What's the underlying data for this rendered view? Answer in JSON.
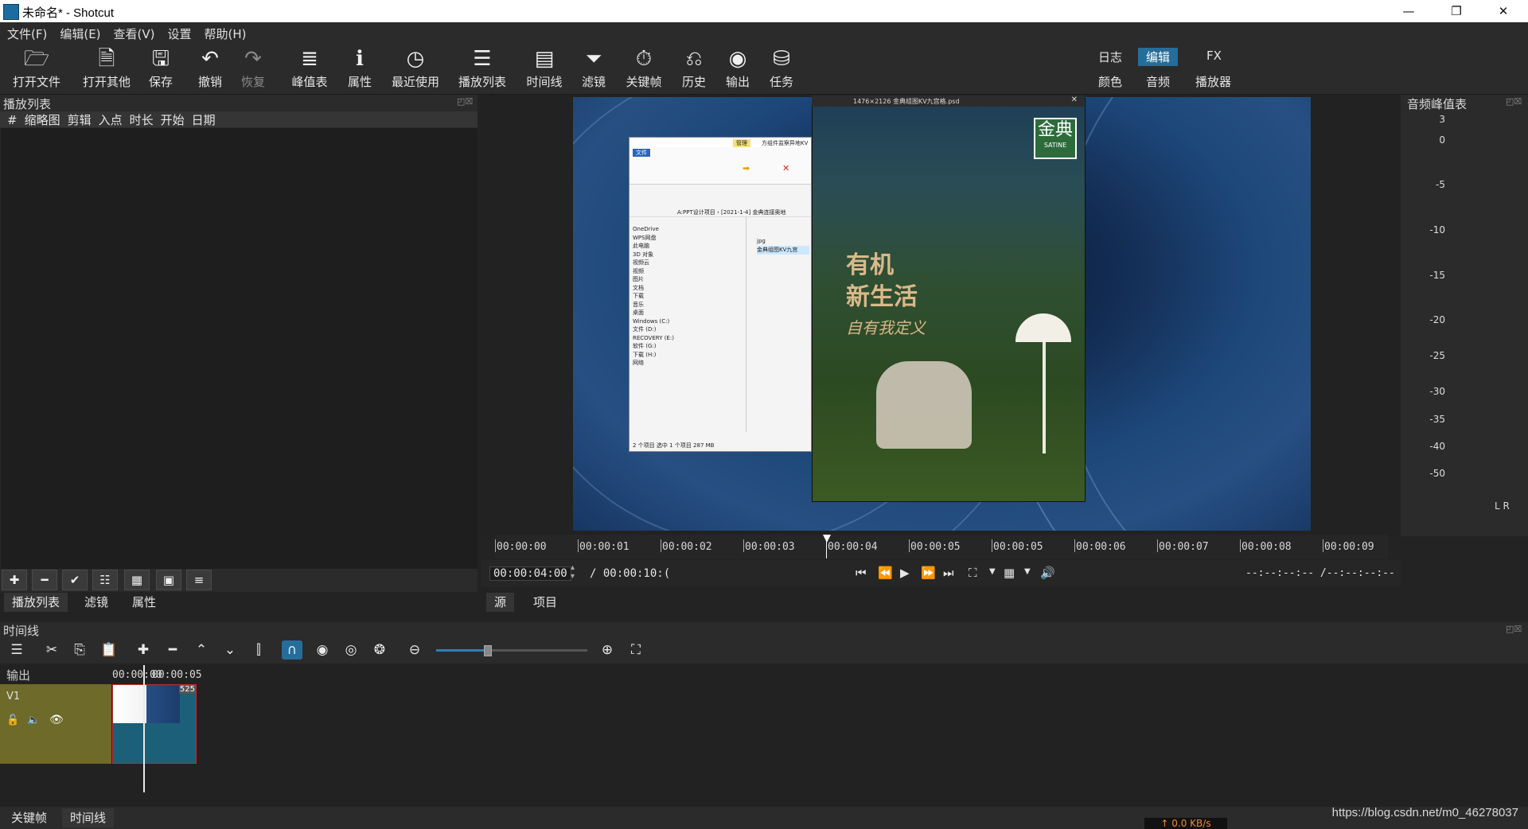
{
  "window": {
    "title": "未命名* - Shotcut",
    "minimize": "—",
    "restore": "❐",
    "close": "✕"
  },
  "menu": [
    "文件(F)",
    "编辑(E)",
    "查看(V)",
    "设置",
    "帮助(H)"
  ],
  "toolbar": {
    "buttons": [
      {
        "label": "打开文件",
        "icon": "folder-open-icon",
        "glyph": "🗁"
      },
      {
        "label": "打开其他",
        "icon": "file-add-icon",
        "glyph": "🗎"
      },
      {
        "label": "保存",
        "icon": "save-icon",
        "glyph": "🖫"
      },
      {
        "label": "撤销",
        "icon": "undo-icon",
        "glyph": "↶"
      },
      {
        "label": "恢复",
        "icon": "redo-icon",
        "glyph": "↷"
      },
      {
        "label": "峰值表",
        "icon": "meter-icon",
        "glyph": "≣"
      },
      {
        "label": "属性",
        "icon": "info-icon",
        "glyph": "ℹ"
      },
      {
        "label": "最近使用",
        "icon": "clock-icon",
        "glyph": "◷"
      },
      {
        "label": "播放列表",
        "icon": "list-icon",
        "glyph": "☰"
      },
      {
        "label": "时间线",
        "icon": "timeline-icon",
        "glyph": "▤"
      },
      {
        "label": "滤镜",
        "icon": "filter-icon",
        "glyph": "⏷"
      },
      {
        "label": "关键帧",
        "icon": "stopwatch-icon",
        "glyph": "⏱"
      },
      {
        "label": "历史",
        "icon": "history-icon",
        "glyph": "⎌"
      },
      {
        "label": "输出",
        "icon": "export-icon",
        "glyph": "◉"
      },
      {
        "label": "任务",
        "icon": "jobs-icon",
        "glyph": "⛁"
      }
    ],
    "layouts": {
      "log": "日志",
      "edit": "编辑",
      "fx": "FX",
      "color": "颜色",
      "audio": "音频",
      "player": "播放器"
    }
  },
  "playlist": {
    "title": "播放列表",
    "columns": [
      "#",
      "缩略图",
      "剪辑",
      "入点",
      "时长",
      "开始",
      "日期"
    ],
    "tabs": [
      "播放列表",
      "滤镜",
      "属性"
    ]
  },
  "preview": {
    "explorer_title": "方组件监察异地KV",
    "explorer_path": "A:PPT设计项目 › [2021-1-4] 金典连接奥地",
    "explorer_nav": [
      "OneDrive",
      "WPS网盘",
      "此电脑",
      "3D 对象",
      "视频云",
      "视频",
      "图片",
      "文档",
      "下载",
      "音乐",
      "桌面",
      "Windows (C:)",
      "文件 (D:)",
      "RECOVERY (E:)",
      "软件 (G:)",
      "下载 (H:)",
      "网络"
    ],
    "explorer_files": [
      "jpg",
      "金典组图KV九宫"
    ],
    "explorer_status": "2 个项目   选中 1 个项目  287 MB",
    "poster_bar": "1476×2126 金典组图KV九宫格.psd",
    "poster_logo": "金典",
    "poster_logo_sub": "SATINE",
    "poster_heading1": "有机",
    "poster_heading2": "新生活",
    "poster_sub": "自有我定义"
  },
  "meter": {
    "title": "音频峰值表",
    "marks": [
      "3",
      "0",
      "-5",
      "-10",
      "-15",
      "-20",
      "-25",
      "-30",
      "-35",
      "-40",
      "-50"
    ],
    "lr": "L R"
  },
  "ruler": {
    "ticks": [
      "00:00:00",
      "00:00:01",
      "00:00:02",
      "00:00:03",
      "00:00:04",
      "00:00:05",
      "00:00:05",
      "00:00:06",
      "00:00:07",
      "00:00:08",
      "00:00:09"
    ]
  },
  "transport": {
    "position": "00:00:04:00",
    "duration": "/ 00:00:10:(",
    "in_out": "--:--:--:-- /--:--:--:--",
    "source_tab": "源",
    "project_tab": "项目"
  },
  "timeline": {
    "title": "时间线",
    "output_label": "输出",
    "track_name": "V1",
    "ruler_times": [
      "00:00:00",
      "00:00:05"
    ],
    "clip_badge": "525"
  },
  "bottom": {
    "tabs": [
      "关键帧",
      "时间线"
    ],
    "watermark": "https://blog.csdn.net/m0_46278037",
    "netspeed": "↑ 0.0 KB/s"
  }
}
